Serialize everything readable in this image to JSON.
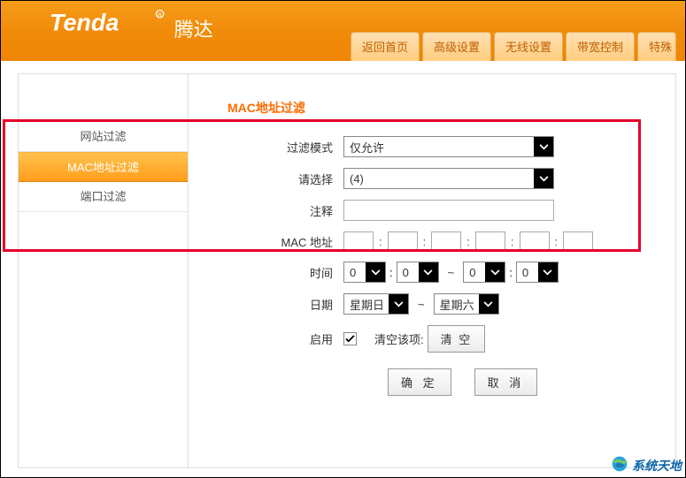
{
  "header": {
    "brand_cn": "腾达",
    "tabs": [
      "返回首页",
      "高级设置",
      "无线设置",
      "带宽控制",
      "特殊"
    ]
  },
  "sidebar": {
    "items": [
      "网站过滤",
      "MAC地址过滤",
      "端口过滤"
    ],
    "active_index": 1
  },
  "page": {
    "title": "MAC地址过滤"
  },
  "form": {
    "filter_mode": {
      "label": "过滤模式",
      "value": "仅允许"
    },
    "select_item": {
      "label": "请选择",
      "value": "(4)"
    },
    "comment": {
      "label": "注释",
      "value": ""
    },
    "mac": {
      "label": "MAC 地址",
      "segments": [
        "",
        "",
        "",
        "",
        "",
        ""
      ]
    },
    "time": {
      "label": "时间",
      "h1": "0",
      "m1": "0",
      "h2": "0",
      "m2": "0",
      "sep": "~"
    },
    "date": {
      "label": "日期",
      "from": "星期日",
      "to": "星期六",
      "sep": "~"
    },
    "enable": {
      "label": "启用",
      "checked": true,
      "clear_label": "清空该项:",
      "clear_btn": "清 空"
    },
    "buttons": {
      "ok": "确 定",
      "cancel": "取 消"
    }
  },
  "watermark": "系统天地"
}
